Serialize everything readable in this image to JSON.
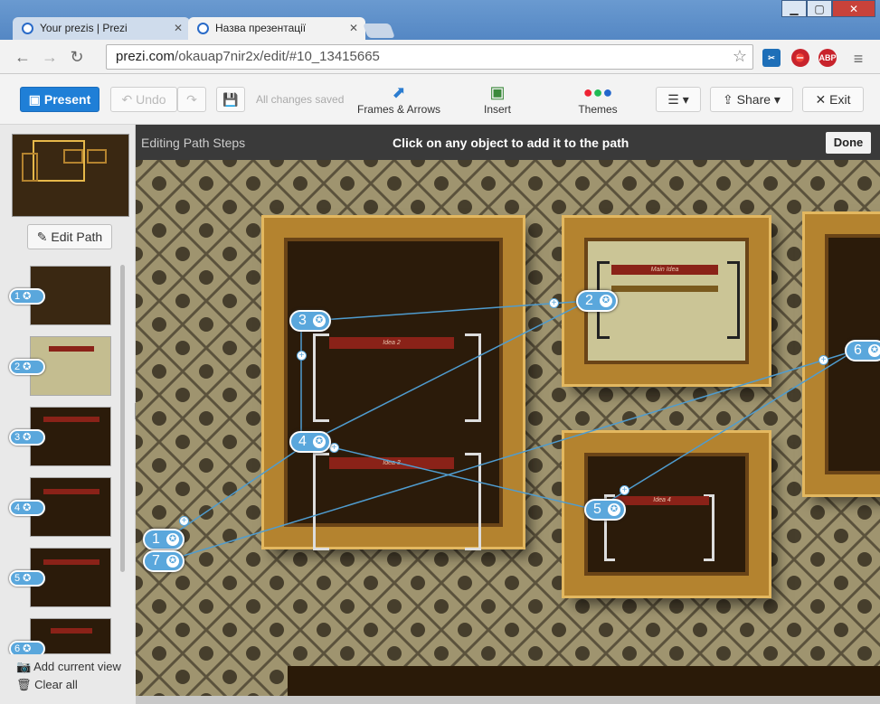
{
  "browser": {
    "tabs": [
      {
        "title": "Your prezis | Prezi"
      },
      {
        "title": "Назва презентації"
      }
    ],
    "url_host": "prezi.com",
    "url_path": "/okauap7nir2x/edit/#10_13415665"
  },
  "toolbar": {
    "present_label": "Present",
    "undo_label": "Undo",
    "save_status": "All changes saved",
    "frames_label": "Frames & Arrows",
    "insert_label": "Insert",
    "themes_label": "Themes",
    "share_label": "Share",
    "exit_label": "Exit"
  },
  "sidebar": {
    "edit_path_label": "Edit Path",
    "steps": [
      "1",
      "2",
      "3",
      "4",
      "5",
      "6"
    ],
    "add_current_view_label": "Add current view",
    "clear_all_label": "Clear all"
  },
  "editbar": {
    "left_label": "Editing Path Steps",
    "center_label": "Click on any object to add it to the path",
    "done_label": "Done"
  },
  "canvas": {
    "badges": [
      "3",
      "2",
      "6",
      "4",
      "1",
      "7",
      "5"
    ],
    "frame_texts": {
      "idea2": "Idea 2",
      "main_idea": "Main Idea",
      "idea3": "Idea 3",
      "idea4": "Idea 4"
    }
  }
}
